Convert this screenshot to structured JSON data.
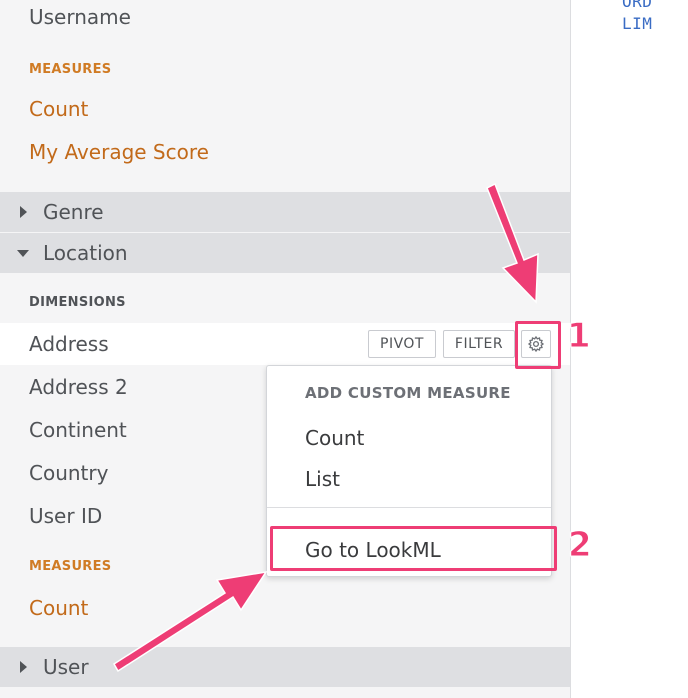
{
  "sidebar": {
    "top_field": "Username",
    "measures_label_1": "MEASURES",
    "measures_1": [
      "Count",
      "My Average Score"
    ],
    "groups": [
      {
        "label": "Genre",
        "expanded": false
      },
      {
        "label": "Location",
        "expanded": true
      }
    ],
    "dimensions_label": "DIMENSIONS",
    "dimensions": [
      "Address",
      "Address 2",
      "Continent",
      "Country",
      "User ID"
    ],
    "measures_label_2": "MEASURES",
    "measures_2": [
      "Count"
    ],
    "bottom_group": {
      "label": "User",
      "expanded": false
    }
  },
  "row_actions": {
    "pivot_label": "PIVOT",
    "filter_label": "FILTER",
    "gear_icon": "gear-icon"
  },
  "menu": {
    "title": "ADD CUSTOM MEASURE",
    "items": [
      "Count",
      "List"
    ],
    "lookml_item": "Go to LookML"
  },
  "sql_pane": {
    "lines": [
      "ORD",
      "LIM"
    ]
  },
  "annotations": {
    "badge_1": "1",
    "badge_2": "2",
    "color": "#ee3d75"
  },
  "colors": {
    "measure": "#c26a1a",
    "sql": "#3a6cc4",
    "group_bg": "#dedfe2"
  }
}
